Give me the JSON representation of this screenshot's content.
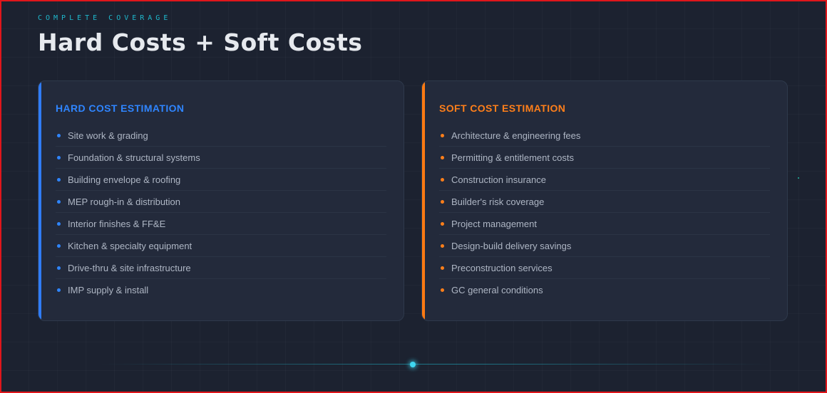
{
  "header": {
    "eyebrow": "COMPLETE COVERAGE",
    "title": "Hard Costs + Soft Costs"
  },
  "hard_costs": {
    "title": "HARD COST ESTIMATION",
    "accent_color": "#2f7cf6",
    "items": [
      "Site work & grading",
      "Foundation & structural systems",
      "Building envelope & roofing",
      "MEP rough-in & distribution",
      "Interior finishes & FF&E",
      "Kitchen & specialty equipment",
      "Drive-thru & site infrastructure",
      "IMP supply & install"
    ]
  },
  "soft_costs": {
    "title": "SOFT COST ESTIMATION",
    "accent_color": "#ff7a12",
    "items": [
      "Architecture & engineering fees",
      "Permitting & entitlement costs",
      "Construction insurance",
      "Builder's risk coverage",
      "Project management",
      "Design-build delivery savings",
      "Preconstruction services",
      "GC general conditions"
    ]
  }
}
